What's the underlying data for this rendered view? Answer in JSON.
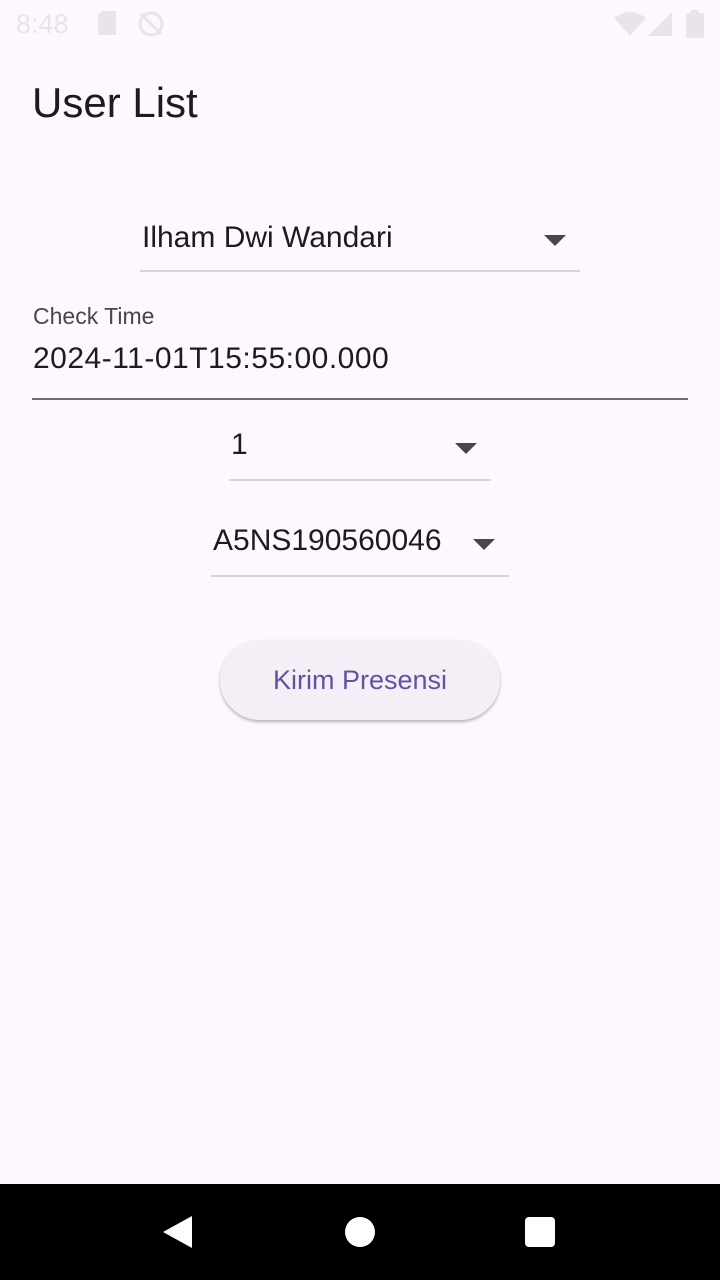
{
  "status_bar": {
    "time": "8:48",
    "icons": [
      "sd-card-icon",
      "no-sync-icon",
      "wifi-icon",
      "signal-icon",
      "battery-icon"
    ]
  },
  "app_bar": {
    "title": "User List"
  },
  "form": {
    "user_dropdown": {
      "selected": "Ilham Dwi Wandari"
    },
    "check_time": {
      "label": "Check Time",
      "value": "2024-11-01T15:55:00.000"
    },
    "type_dropdown": {
      "selected": "1"
    },
    "device_dropdown": {
      "selected": "A5NS190560046"
    },
    "submit_label": "Kirim Presensi"
  },
  "nav_bar": {
    "icons": [
      "back-icon",
      "home-icon",
      "recents-icon"
    ]
  },
  "colors": {
    "background": "#FDF7FE",
    "primary": "#6750A4",
    "button_bg": "#F4EFF6",
    "nav_bar": "#000000"
  }
}
